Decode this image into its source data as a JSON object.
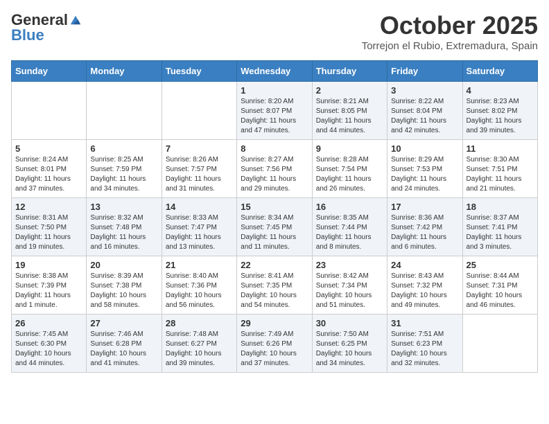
{
  "header": {
    "logo_general": "General",
    "logo_blue": "Blue",
    "month": "October 2025",
    "location": "Torrejon el Rubio, Extremadura, Spain"
  },
  "weekdays": [
    "Sunday",
    "Monday",
    "Tuesday",
    "Wednesday",
    "Thursday",
    "Friday",
    "Saturday"
  ],
  "weeks": [
    [
      {
        "day": "",
        "info": ""
      },
      {
        "day": "",
        "info": ""
      },
      {
        "day": "",
        "info": ""
      },
      {
        "day": "1",
        "info": "Sunrise: 8:20 AM\nSunset: 8:07 PM\nDaylight: 11 hours\nand 47 minutes."
      },
      {
        "day": "2",
        "info": "Sunrise: 8:21 AM\nSunset: 8:05 PM\nDaylight: 11 hours\nand 44 minutes."
      },
      {
        "day": "3",
        "info": "Sunrise: 8:22 AM\nSunset: 8:04 PM\nDaylight: 11 hours\nand 42 minutes."
      },
      {
        "day": "4",
        "info": "Sunrise: 8:23 AM\nSunset: 8:02 PM\nDaylight: 11 hours\nand 39 minutes."
      }
    ],
    [
      {
        "day": "5",
        "info": "Sunrise: 8:24 AM\nSunset: 8:01 PM\nDaylight: 11 hours\nand 37 minutes."
      },
      {
        "day": "6",
        "info": "Sunrise: 8:25 AM\nSunset: 7:59 PM\nDaylight: 11 hours\nand 34 minutes."
      },
      {
        "day": "7",
        "info": "Sunrise: 8:26 AM\nSunset: 7:57 PM\nDaylight: 11 hours\nand 31 minutes."
      },
      {
        "day": "8",
        "info": "Sunrise: 8:27 AM\nSunset: 7:56 PM\nDaylight: 11 hours\nand 29 minutes."
      },
      {
        "day": "9",
        "info": "Sunrise: 8:28 AM\nSunset: 7:54 PM\nDaylight: 11 hours\nand 26 minutes."
      },
      {
        "day": "10",
        "info": "Sunrise: 8:29 AM\nSunset: 7:53 PM\nDaylight: 11 hours\nand 24 minutes."
      },
      {
        "day": "11",
        "info": "Sunrise: 8:30 AM\nSunset: 7:51 PM\nDaylight: 11 hours\nand 21 minutes."
      }
    ],
    [
      {
        "day": "12",
        "info": "Sunrise: 8:31 AM\nSunset: 7:50 PM\nDaylight: 11 hours\nand 19 minutes."
      },
      {
        "day": "13",
        "info": "Sunrise: 8:32 AM\nSunset: 7:48 PM\nDaylight: 11 hours\nand 16 minutes."
      },
      {
        "day": "14",
        "info": "Sunrise: 8:33 AM\nSunset: 7:47 PM\nDaylight: 11 hours\nand 13 minutes."
      },
      {
        "day": "15",
        "info": "Sunrise: 8:34 AM\nSunset: 7:45 PM\nDaylight: 11 hours\nand 11 minutes."
      },
      {
        "day": "16",
        "info": "Sunrise: 8:35 AM\nSunset: 7:44 PM\nDaylight: 11 hours\nand 8 minutes."
      },
      {
        "day": "17",
        "info": "Sunrise: 8:36 AM\nSunset: 7:42 PM\nDaylight: 11 hours\nand 6 minutes."
      },
      {
        "day": "18",
        "info": "Sunrise: 8:37 AM\nSunset: 7:41 PM\nDaylight: 11 hours\nand 3 minutes."
      }
    ],
    [
      {
        "day": "19",
        "info": "Sunrise: 8:38 AM\nSunset: 7:39 PM\nDaylight: 11 hours\nand 1 minute."
      },
      {
        "day": "20",
        "info": "Sunrise: 8:39 AM\nSunset: 7:38 PM\nDaylight: 10 hours\nand 58 minutes."
      },
      {
        "day": "21",
        "info": "Sunrise: 8:40 AM\nSunset: 7:36 PM\nDaylight: 10 hours\nand 56 minutes."
      },
      {
        "day": "22",
        "info": "Sunrise: 8:41 AM\nSunset: 7:35 PM\nDaylight: 10 hours\nand 54 minutes."
      },
      {
        "day": "23",
        "info": "Sunrise: 8:42 AM\nSunset: 7:34 PM\nDaylight: 10 hours\nand 51 minutes."
      },
      {
        "day": "24",
        "info": "Sunrise: 8:43 AM\nSunset: 7:32 PM\nDaylight: 10 hours\nand 49 minutes."
      },
      {
        "day": "25",
        "info": "Sunrise: 8:44 AM\nSunset: 7:31 PM\nDaylight: 10 hours\nand 46 minutes."
      }
    ],
    [
      {
        "day": "26",
        "info": "Sunrise: 7:45 AM\nSunset: 6:30 PM\nDaylight: 10 hours\nand 44 minutes."
      },
      {
        "day": "27",
        "info": "Sunrise: 7:46 AM\nSunset: 6:28 PM\nDaylight: 10 hours\nand 41 minutes."
      },
      {
        "day": "28",
        "info": "Sunrise: 7:48 AM\nSunset: 6:27 PM\nDaylight: 10 hours\nand 39 minutes."
      },
      {
        "day": "29",
        "info": "Sunrise: 7:49 AM\nSunset: 6:26 PM\nDaylight: 10 hours\nand 37 minutes."
      },
      {
        "day": "30",
        "info": "Sunrise: 7:50 AM\nSunset: 6:25 PM\nDaylight: 10 hours\nand 34 minutes."
      },
      {
        "day": "31",
        "info": "Sunrise: 7:51 AM\nSunset: 6:23 PM\nDaylight: 10 hours\nand 32 minutes."
      },
      {
        "day": "",
        "info": ""
      }
    ]
  ]
}
